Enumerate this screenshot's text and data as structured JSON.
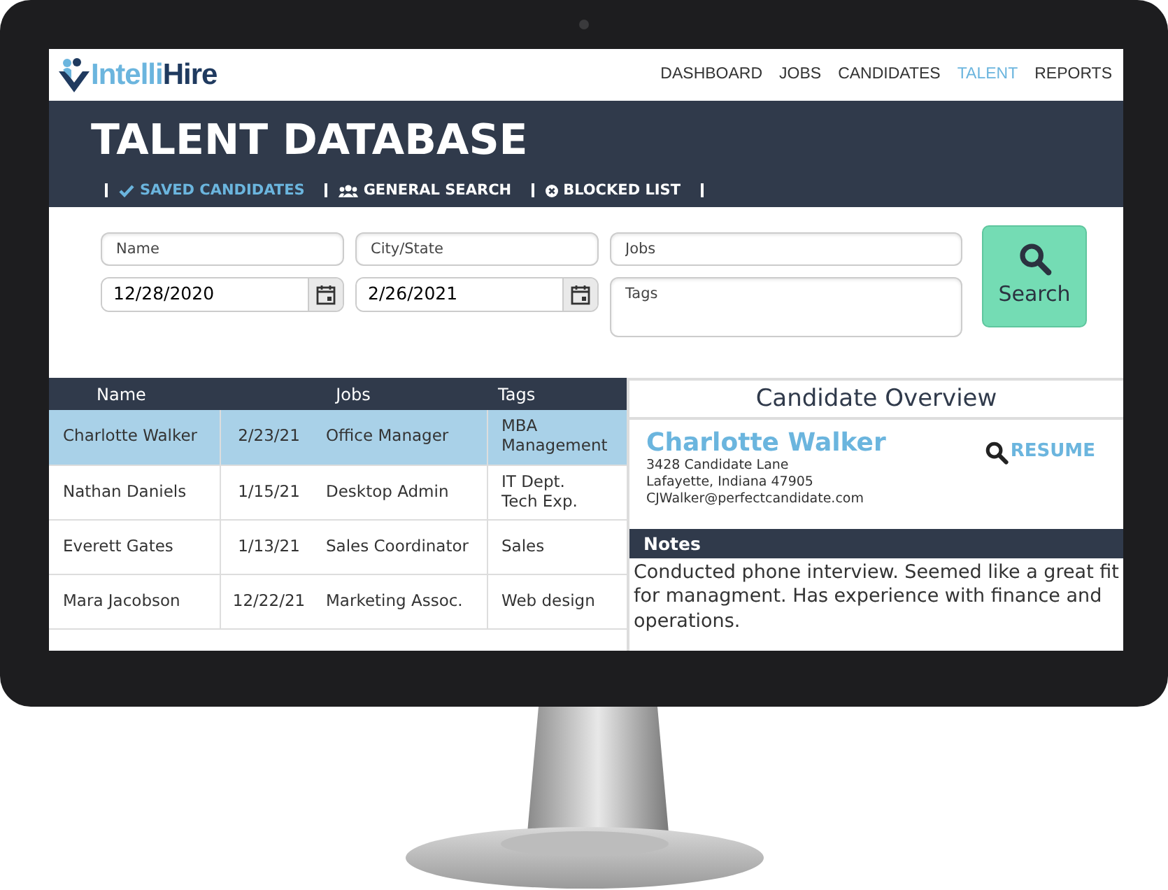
{
  "navbar": {
    "logo": {
      "part_1": "Intelli",
      "part_2": "Hire"
    },
    "items": [
      {
        "label": "DASHBOARD",
        "selected": false
      },
      {
        "label": "JOBS",
        "selected": false
      },
      {
        "label": "CANDIDATES",
        "selected": false
      },
      {
        "label": "TALENT",
        "selected": true
      },
      {
        "label": "REPORTS",
        "selected": false
      }
    ]
  },
  "header": {
    "title": "TALENT DATABASE",
    "tabs": [
      {
        "label": "SAVED CANDIDATES",
        "kind": "check",
        "selected": true
      },
      {
        "label": "GENERAL SEARCH",
        "kind": "users",
        "selected": false
      },
      {
        "label": "BLOCKED LIST",
        "kind": "blocked",
        "selected": false
      }
    ]
  },
  "search": {
    "name": {
      "placeholder": "Name"
    },
    "city_state": {
      "placeholder": "City/State"
    },
    "jobs": {
      "placeholder": "Jobs"
    },
    "date_from": {
      "value": "12/28/2020"
    },
    "date_to": {
      "value": "2/26/2021"
    },
    "tags": {
      "placeholder": "Tags"
    },
    "button": "Search"
  },
  "table": {
    "columns": [
      "Name",
      "Jobs",
      "Tags"
    ],
    "rows": [
      {
        "name": "Charlotte Walker",
        "date": "2/23/21",
        "job": "Office Manager",
        "tags": [
          "MBA",
          "Management"
        ],
        "selected": true
      },
      {
        "name": "Nathan Daniels",
        "date": "1/15/21",
        "job": "Desktop Admin",
        "tags": [
          "IT Dept.",
          "Tech Exp."
        ],
        "selected": false
      },
      {
        "name": "Everett Gates",
        "date": "1/13/21",
        "job": "Sales Coordinator",
        "tags": [
          "Sales"
        ],
        "selected": false
      },
      {
        "name": "Mara Jacobson",
        "date": "12/22/21",
        "job": "Marketing Assoc.",
        "tags": [
          "Web design"
        ],
        "selected": false
      }
    ]
  },
  "overview": {
    "title": "Candidate Overview",
    "name": "Charlotte Walker",
    "resume": "RESUME",
    "address": [
      "3428 Candidate Lane",
      "Lafayette, Indiana 47905"
    ],
    "email": "CJWalker@perfectcandidate.com",
    "notes_title": "Notes",
    "notes": "Conducted phone interview. Seemed like a great fit for managment. Has experience with finance and operations."
  }
}
